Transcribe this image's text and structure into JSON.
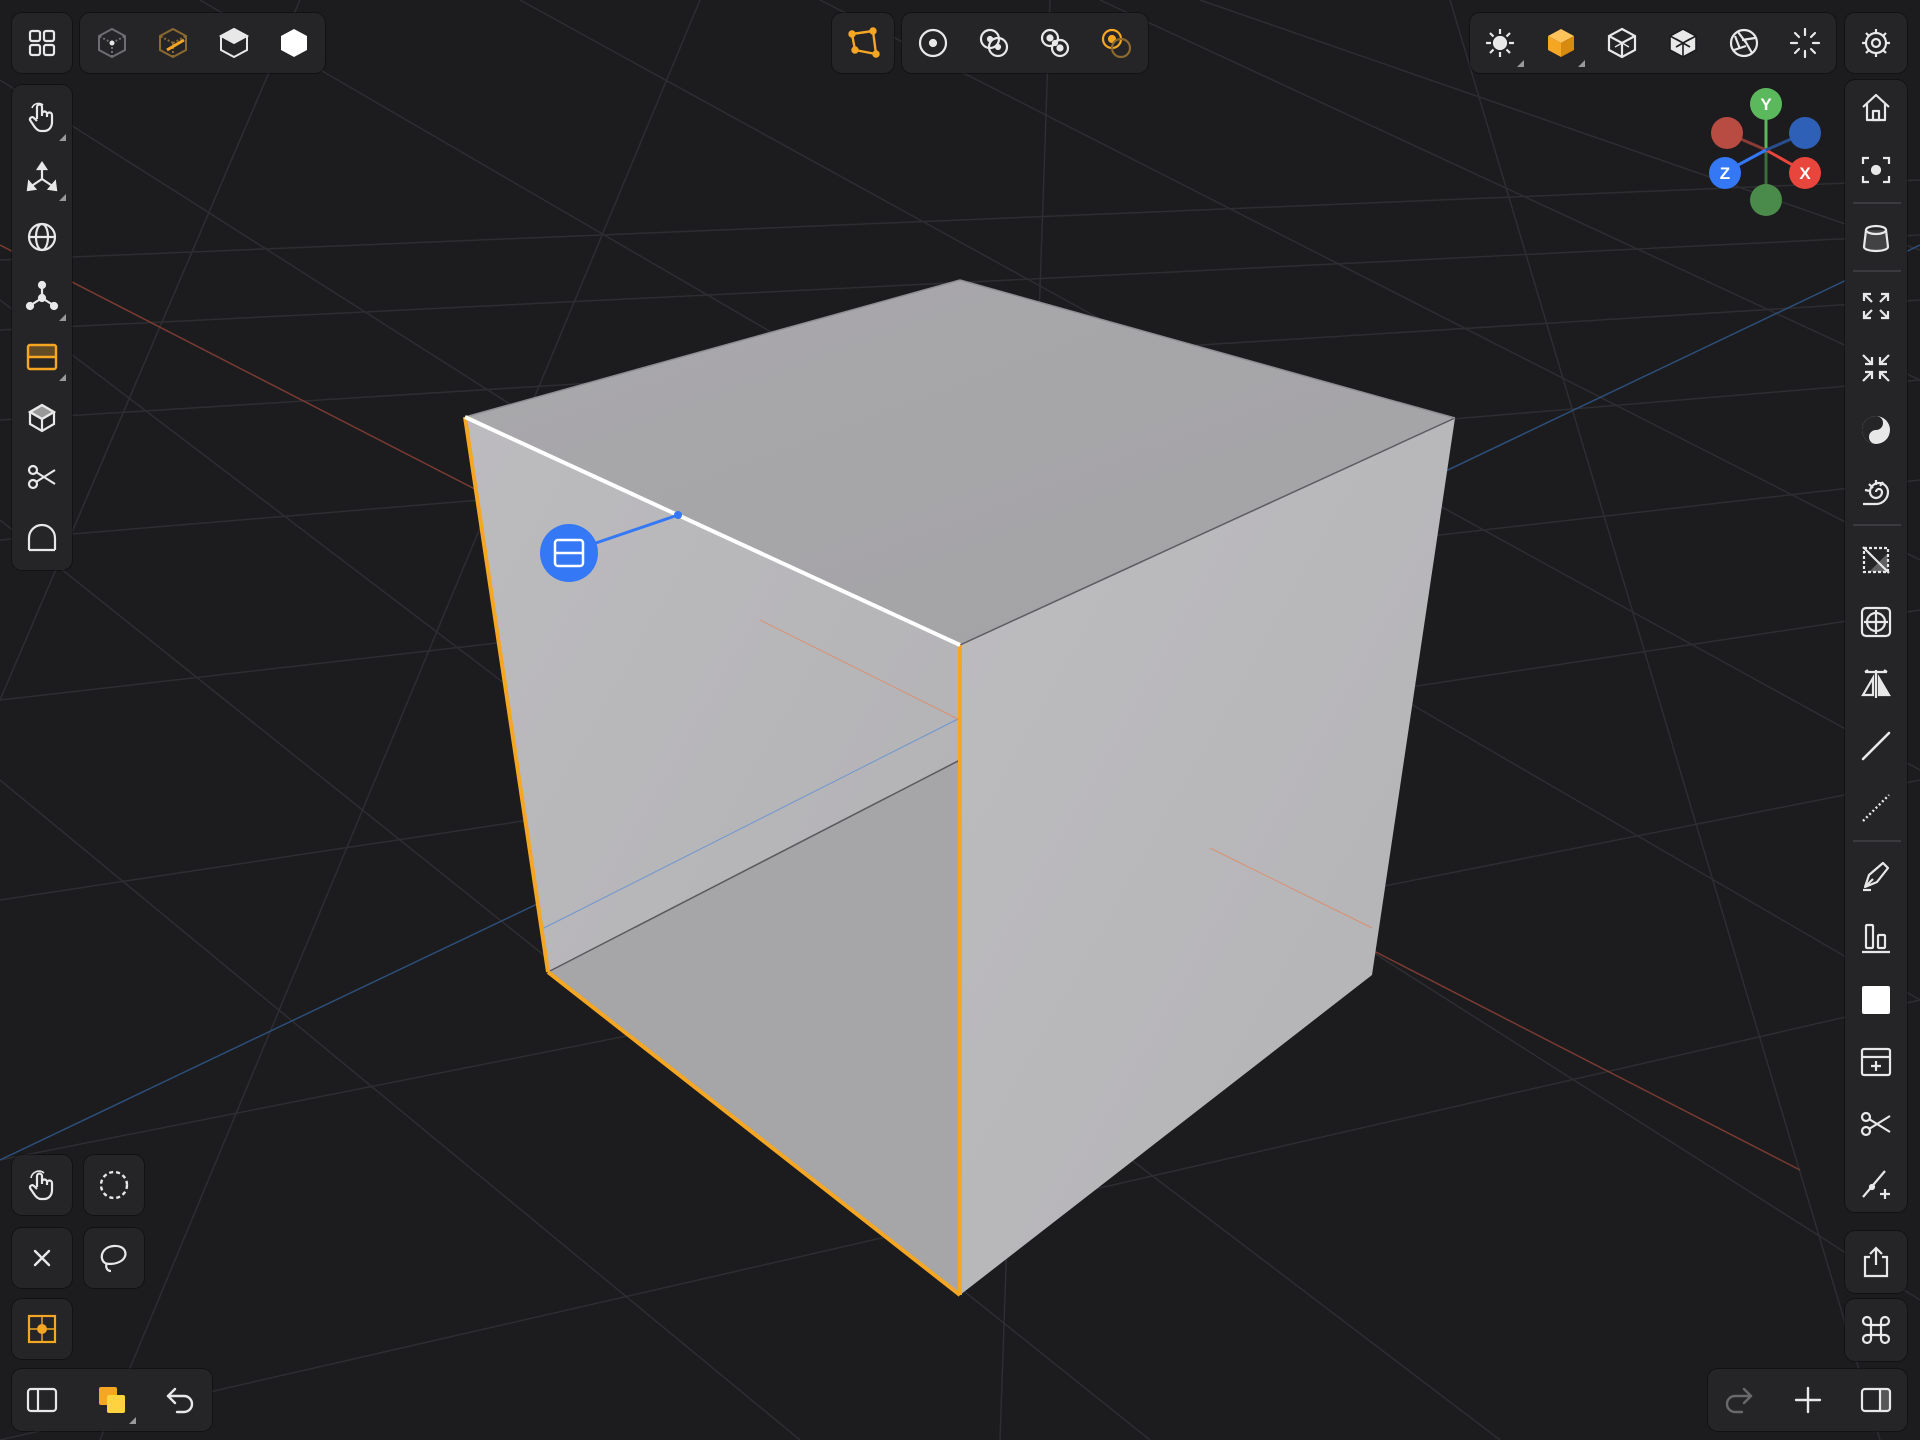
{
  "app": {
    "colors": {
      "background": "#1c1b1e",
      "panel": "#252427",
      "icon": "#e8e8e8",
      "accent_orange": "#f5a623",
      "selection_blue": "#3478f6",
      "axis_x": "#e8453c",
      "axis_y": "#5cb85c",
      "axis_z": "#3478f6"
    }
  },
  "toolbars": {
    "top_left": {
      "items": [
        {
          "name": "grid-menu-icon",
          "state": "normal"
        },
        {
          "name": "point-select-mode-icon",
          "state": "dimmed"
        },
        {
          "name": "edge-select-mode-icon",
          "state": "active-orange"
        },
        {
          "name": "face-select-mode-icon",
          "state": "normal"
        },
        {
          "name": "object-select-mode-icon",
          "state": "normal"
        }
      ]
    },
    "top_center": {
      "items": [
        {
          "name": "polygon-snap-icon",
          "state": "active-orange"
        },
        {
          "name": "pivot-center-icon",
          "state": "normal"
        },
        {
          "name": "pivot-individual-icon",
          "state": "normal"
        },
        {
          "name": "pivot-median-icon",
          "state": "normal"
        },
        {
          "name": "pivot-active-icon",
          "state": "active-orange"
        }
      ]
    },
    "top_right": {
      "items": [
        {
          "name": "lighting-icon",
          "state": "normal"
        },
        {
          "name": "solid-shading-icon",
          "state": "active-orange"
        },
        {
          "name": "wireframe-cube-icon",
          "state": "normal"
        },
        {
          "name": "xray-cube-icon",
          "state": "normal"
        },
        {
          "name": "render-aperture-icon",
          "state": "normal"
        },
        {
          "name": "effects-sparkle-icon",
          "state": "normal"
        },
        {
          "name": "settings-gear-icon",
          "state": "normal"
        }
      ]
    },
    "left": {
      "items": [
        "touch-select-icon",
        "move-gizmo-icon",
        "rotate-sphere-icon",
        "transform-axes-icon",
        "loop-cut-icon",
        "extrude-icon",
        "knife-scissors-icon",
        "bevel-arch-icon"
      ]
    },
    "right": {
      "items": [
        "home-view-icon",
        "focus-frame-icon",
        "cylinder-primitive-icon",
        "expand-arrows-icon",
        "contract-arrows-icon",
        "smooth-shade-icon",
        "spiral-shell-icon",
        "hide-toggle-icon",
        "crosshair-target-icon",
        "mirror-icon",
        "straight-line-icon",
        "dashed-line-icon",
        "pen-draw-icon",
        "align-bars-icon",
        "fill-square-icon",
        "add-frame-icon",
        "scissors-icon",
        "add-edge-icon",
        "share-export-icon",
        "command-key-icon",
        "sidebar-right-icon"
      ]
    },
    "bottom_left": {
      "items": [
        "touch-hand-icon",
        "circle-select-icon",
        "close-icon",
        "lasso-select-icon",
        "snap-target-icon",
        "sidebar-left-icon",
        "layers-icon",
        "undo-icon"
      ]
    },
    "bottom_right": {
      "items": [
        {
          "name": "redo-icon",
          "state": "disabled"
        },
        {
          "name": "add-icon",
          "state": "normal"
        },
        {
          "name": "sidebar-right-icon",
          "state": "normal"
        }
      ]
    }
  },
  "gizmo": {
    "labels": {
      "x": "X",
      "y": "Y",
      "z": "Z"
    }
  },
  "viewport": {
    "object": "cube",
    "operation_badge": "loop-cut-handle-icon"
  }
}
